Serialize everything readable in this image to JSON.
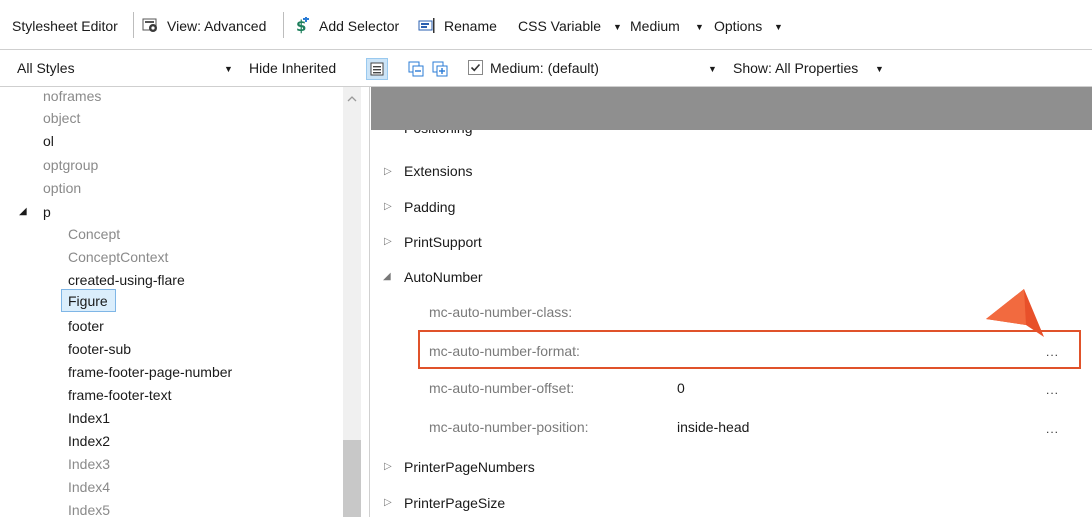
{
  "toolbar": {
    "title": "Stylesheet Editor",
    "view": "View: Advanced",
    "add_selector": "Add Selector",
    "rename": "Rename",
    "css_variable": "CSS Variable",
    "medium": "Medium",
    "options": "Options"
  },
  "filterbar": {
    "all_styles": "All Styles",
    "hide_inherited": "Hide Inherited",
    "medium_checkbox": "Medium: (default)",
    "show": "Show: All Properties"
  },
  "tree": {
    "items": [
      {
        "label": "noframes"
      },
      {
        "label": "object"
      },
      {
        "label": "ol"
      },
      {
        "label": "optgroup"
      },
      {
        "label": "option"
      },
      {
        "label": "p"
      },
      {
        "label": "Concept"
      },
      {
        "label": "ConceptContext"
      },
      {
        "label": "created-using-flare"
      },
      {
        "label": "Figure"
      },
      {
        "label": "footer"
      },
      {
        "label": "footer-sub"
      },
      {
        "label": "frame-footer-page-number"
      },
      {
        "label": "frame-footer-text"
      },
      {
        "label": "Index1"
      },
      {
        "label": "Index2"
      },
      {
        "label": "Index3"
      },
      {
        "label": "Index4"
      },
      {
        "label": "Index5"
      }
    ]
  },
  "properties": {
    "groups": [
      {
        "label": "Positioning"
      },
      {
        "label": "Extensions"
      },
      {
        "label": "Padding"
      },
      {
        "label": "PrintSupport"
      },
      {
        "label": "AutoNumber"
      },
      {
        "label": "PrinterPageNumbers"
      },
      {
        "label": "PrinterPageSize"
      }
    ],
    "autonumber": [
      {
        "name": "mc-auto-number-class:",
        "value": ""
      },
      {
        "name": "mc-auto-number-format:",
        "value": ""
      },
      {
        "name": "mc-auto-number-offset:",
        "value": "0"
      },
      {
        "name": "mc-auto-number-position:",
        "value": "inside-head"
      }
    ],
    "ellipsis": "..."
  }
}
